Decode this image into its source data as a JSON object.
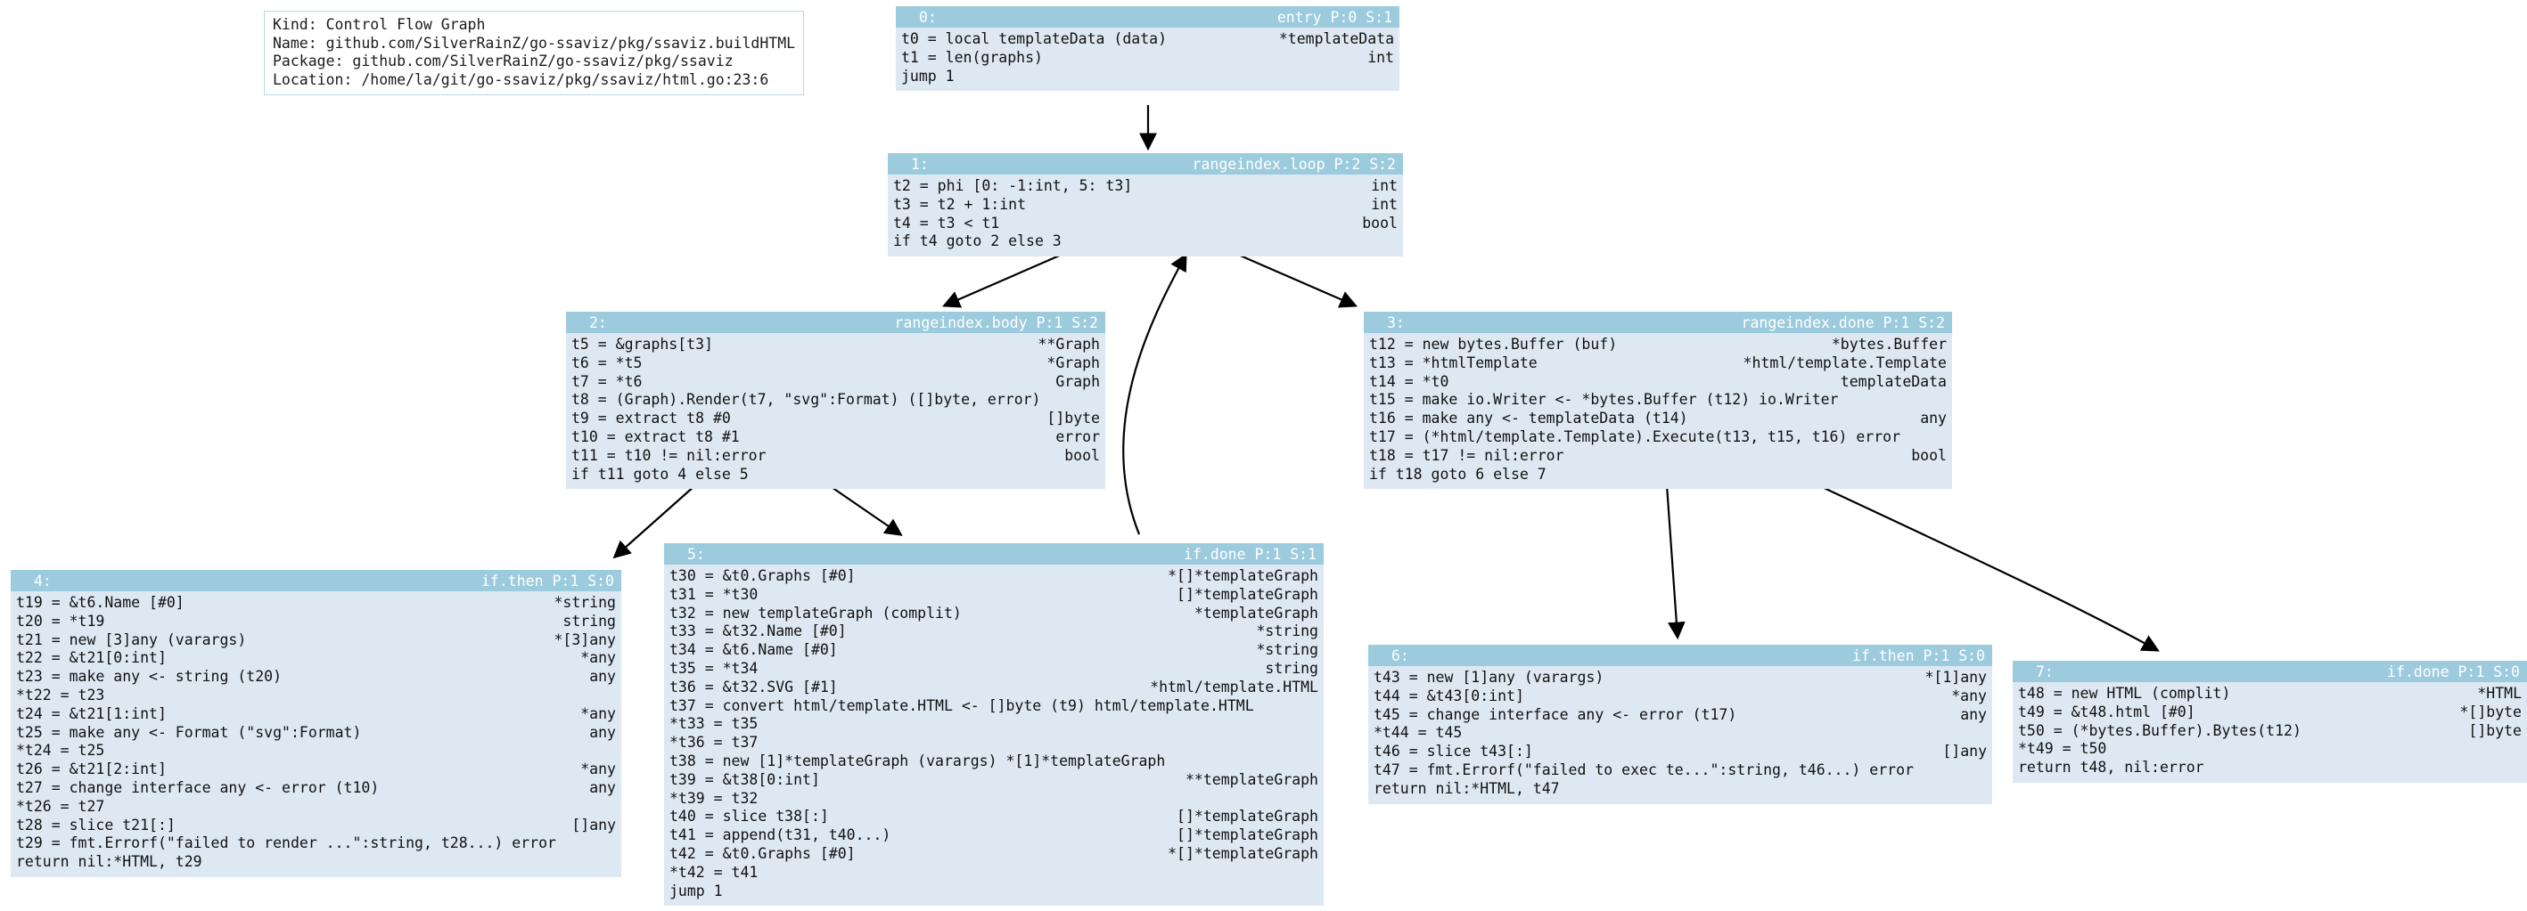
{
  "legend": {
    "lines": [
      "Kind: Control Flow Graph",
      "Name: github.com/SilverRainZ/go-ssaviz/pkg/ssaviz.buildHTML",
      "Package: github.com/SilverRainZ/go-ssaviz/pkg/ssaviz",
      "Location: /home/la/git/go-ssaviz/pkg/ssaviz/html.go:23:6"
    ]
  },
  "colors": {
    "header": "#9ccbdd",
    "body": "#dde8f3",
    "border": "#b9d6e3",
    "edge": "#000000",
    "header_text": "#ffffff"
  },
  "blocks": [
    {
      "id": "0:",
      "title": "entry P:0 S:1",
      "rows": [
        {
          "op": "t0 = local templateData (data)",
          "ty": "*templateData"
        },
        {
          "op": "t1 = len(graphs)",
          "ty": "int"
        },
        {
          "op": "jump 1",
          "ty": ""
        }
      ]
    },
    {
      "id": "1:",
      "title": "rangeindex.loop P:2 S:2",
      "rows": [
        {
          "op": "t2 = phi [0: -1:int, 5: t3]",
          "ty": "int"
        },
        {
          "op": "t3 = t2 + 1:int",
          "ty": "int"
        },
        {
          "op": "t4 = t3 < t1",
          "ty": "bool"
        },
        {
          "op": "if t4 goto 2 else 3",
          "ty": ""
        }
      ]
    },
    {
      "id": "2:",
      "title": "rangeindex.body P:1 S:2",
      "rows": [
        {
          "op": "t5 = &graphs[t3]",
          "ty": "**Graph"
        },
        {
          "op": "t6 = *t5",
          "ty": "*Graph"
        },
        {
          "op": "t7 = *t6",
          "ty": "Graph"
        },
        {
          "op": "t8 = (Graph).Render(t7, \"svg\":Format) ([]byte, error)",
          "ty": ""
        },
        {
          "op": "t9 = extract t8 #0",
          "ty": "[]byte"
        },
        {
          "op": "t10 = extract t8 #1",
          "ty": "error"
        },
        {
          "op": "t11 = t10 != nil:error",
          "ty": "bool"
        },
        {
          "op": "if t11 goto 4 else 5",
          "ty": ""
        }
      ]
    },
    {
      "id": "3:",
      "title": "rangeindex.done P:1 S:2",
      "rows": [
        {
          "op": "t12 = new bytes.Buffer (buf)",
          "ty": "*bytes.Buffer"
        },
        {
          "op": "t13 = *htmlTemplate",
          "ty": "*html/template.Template"
        },
        {
          "op": "t14 = *t0",
          "ty": "templateData"
        },
        {
          "op": "t15 = make io.Writer <- *bytes.Buffer (t12) io.Writer",
          "ty": ""
        },
        {
          "op": "t16 = make any <- templateData (t14)",
          "ty": "any"
        },
        {
          "op": "t17 = (*html/template.Template).Execute(t13, t15, t16) error",
          "ty": ""
        },
        {
          "op": "t18 = t17 != nil:error",
          "ty": "bool"
        },
        {
          "op": "if t18 goto 6 else 7",
          "ty": ""
        }
      ]
    },
    {
      "id": "4:",
      "title": "if.then P:1 S:0",
      "rows": [
        {
          "op": "t19 = &t6.Name [#0]",
          "ty": "*string"
        },
        {
          "op": "t20 = *t19",
          "ty": "string"
        },
        {
          "op": "t21 = new [3]any (varargs)",
          "ty": "*[3]any"
        },
        {
          "op": "t22 = &t21[0:int]",
          "ty": "*any"
        },
        {
          "op": "t23 = make any <- string (t20)",
          "ty": "any"
        },
        {
          "op": "*t22 = t23",
          "ty": ""
        },
        {
          "op": "t24 = &t21[1:int]",
          "ty": "*any"
        },
        {
          "op": "t25 = make any <- Format (\"svg\":Format)",
          "ty": "any"
        },
        {
          "op": "*t24 = t25",
          "ty": ""
        },
        {
          "op": "t26 = &t21[2:int]",
          "ty": "*any"
        },
        {
          "op": "t27 = change interface any <- error (t10)",
          "ty": "any"
        },
        {
          "op": "*t26 = t27",
          "ty": ""
        },
        {
          "op": "t28 = slice t21[:]",
          "ty": "[]any"
        },
        {
          "op": "t29 = fmt.Errorf(\"failed to render ...\":string, t28...) error",
          "ty": ""
        },
        {
          "op": "return nil:*HTML, t29",
          "ty": ""
        }
      ]
    },
    {
      "id": "5:",
      "title": "if.done P:1 S:1",
      "rows": [
        {
          "op": "t30 = &t0.Graphs [#0]",
          "ty": "*[]*templateGraph"
        },
        {
          "op": "t31 = *t30",
          "ty": "[]*templateGraph"
        },
        {
          "op": "t32 = new templateGraph (complit)",
          "ty": "*templateGraph"
        },
        {
          "op": "t33 = &t32.Name [#0]",
          "ty": "*string"
        },
        {
          "op": "t34 = &t6.Name [#0]",
          "ty": "*string"
        },
        {
          "op": "t35 = *t34",
          "ty": "string"
        },
        {
          "op": "t36 = &t32.SVG [#1]",
          "ty": "*html/template.HTML"
        },
        {
          "op": "t37 = convert html/template.HTML <- []byte (t9) html/template.HTML",
          "ty": ""
        },
        {
          "op": "*t33 = t35",
          "ty": ""
        },
        {
          "op": "*t36 = t37",
          "ty": ""
        },
        {
          "op": "t38 = new [1]*templateGraph (varargs) *[1]*templateGraph",
          "ty": ""
        },
        {
          "op": "t39 = &t38[0:int]",
          "ty": "**templateGraph"
        },
        {
          "op": "*t39 = t32",
          "ty": ""
        },
        {
          "op": "t40 = slice t38[:]",
          "ty": "[]*templateGraph"
        },
        {
          "op": "t41 = append(t31, t40...)",
          "ty": "[]*templateGraph"
        },
        {
          "op": "t42 = &t0.Graphs [#0]",
          "ty": "*[]*templateGraph"
        },
        {
          "op": "*t42 = t41",
          "ty": ""
        },
        {
          "op": "jump 1",
          "ty": ""
        }
      ]
    },
    {
      "id": "6:",
      "title": "if.then P:1 S:0",
      "rows": [
        {
          "op": "t43 = new [1]any (varargs)",
          "ty": "*[1]any"
        },
        {
          "op": "t44 = &t43[0:int]",
          "ty": "*any"
        },
        {
          "op": "t45 = change interface any <- error (t17)",
          "ty": "any"
        },
        {
          "op": "*t44 = t45",
          "ty": ""
        },
        {
          "op": "t46 = slice t43[:]",
          "ty": "[]any"
        },
        {
          "op": "t47 = fmt.Errorf(\"failed to exec te...\":string, t46...) error",
          "ty": ""
        },
        {
          "op": "return nil:*HTML, t47",
          "ty": ""
        }
      ]
    },
    {
      "id": "7:",
      "title": "if.done P:1 S:0",
      "rows": [
        {
          "op": "t48 = new HTML (complit)",
          "ty": "*HTML"
        },
        {
          "op": "t49 = &t48.html [#0]",
          "ty": "*[]byte"
        },
        {
          "op": "t50 = (*bytes.Buffer).Bytes(t12)",
          "ty": "[]byte"
        },
        {
          "op": "*t49 = t50",
          "ty": ""
        },
        {
          "op": "return t48, nil:error",
          "ty": ""
        }
      ]
    }
  ],
  "edges": [
    {
      "from": "0",
      "to": "1"
    },
    {
      "from": "1",
      "to": "2"
    },
    {
      "from": "1",
      "to": "3"
    },
    {
      "from": "2",
      "to": "4"
    },
    {
      "from": "2",
      "to": "5"
    },
    {
      "from": "5",
      "to": "1"
    },
    {
      "from": "3",
      "to": "6"
    },
    {
      "from": "3",
      "to": "7"
    }
  ]
}
